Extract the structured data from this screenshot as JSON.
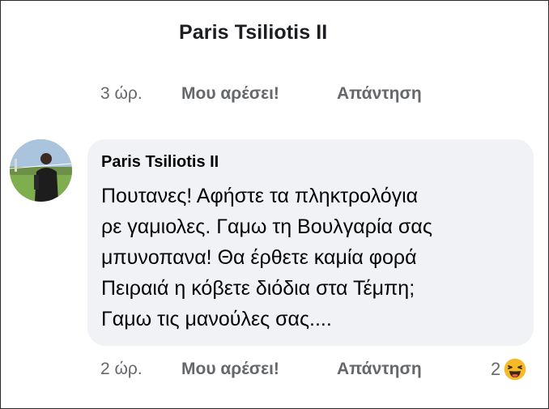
{
  "post": {
    "author": "Paris Tsiliotis II",
    "time": "3 ώρ.",
    "like_label": "Μου αρέσει!",
    "reply_label": "Απάντηση"
  },
  "comment": {
    "author": "Paris Tsiliotis II",
    "lines": [
      "Πουτανες! Αφήστε τα πληκτρολόγια",
      "ρε γαμιολες. Γαμω τη Βουλγαρία σας",
      "μπυνοπανα! Θα έρθετε καμία φορά",
      "Πειραιά η κόβετε διόδια στα Τέμπη;",
      "Γαμω τις μανούλες σας...."
    ],
    "time": "2 ώρ.",
    "like_label": "Μου αρέσει!",
    "reply_label": "Απάντηση",
    "reaction_count": "2",
    "reaction_icon": "haha-emoji-icon"
  }
}
